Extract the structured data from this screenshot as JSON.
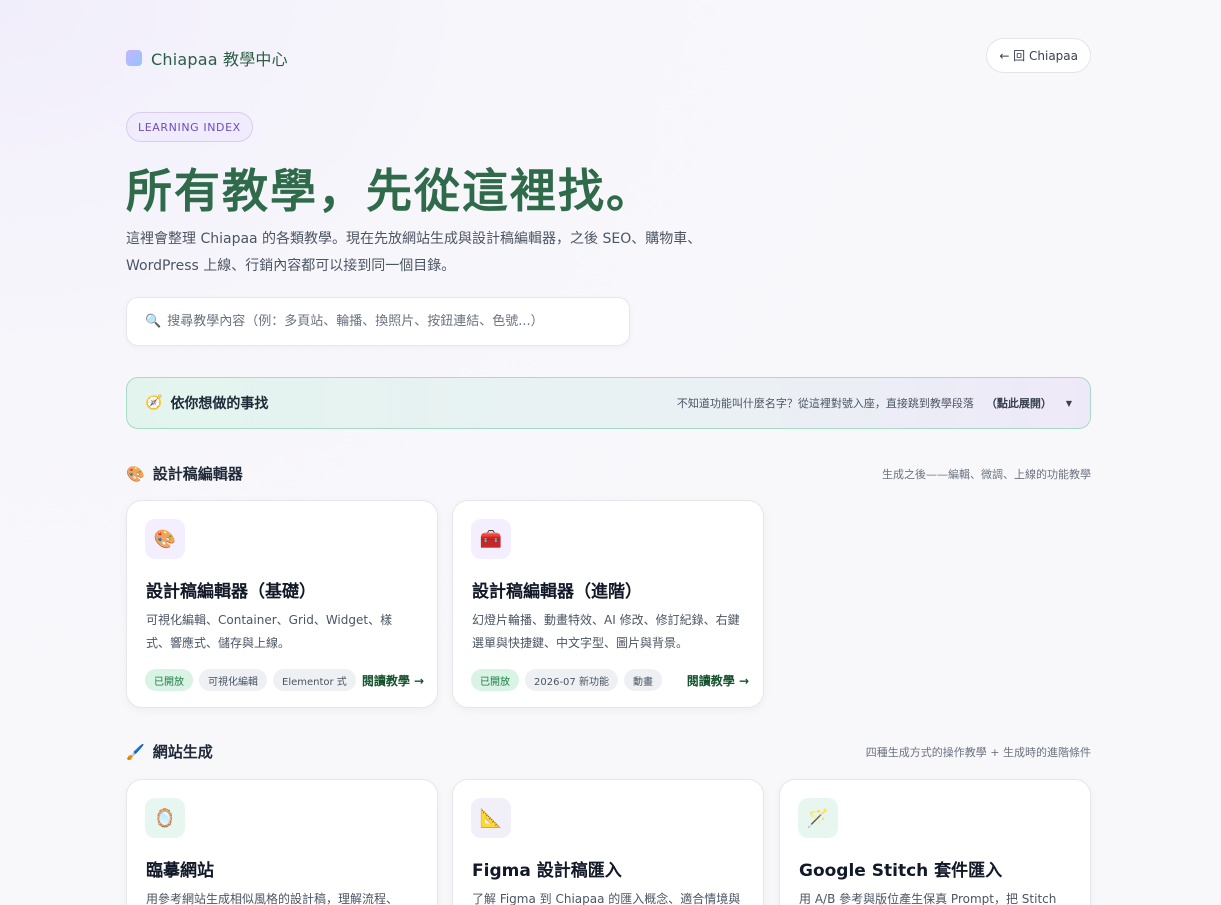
{
  "header": {
    "brand": "Chiapaa 教學中心",
    "back_button": "← 回 Chiapaa"
  },
  "hero": {
    "badge": "LEARNING INDEX",
    "title": "所有教學，先從這裡找。",
    "description": "這裡會整理 Chiapaa 的各類教學。現在先放網站生成與設計稿編輯器，之後 SEO、購物車、WordPress 上線、行銷內容都可以接到同一個目錄。"
  },
  "search": {
    "icon": "search-icon",
    "placeholder": "搜尋教學內容（例：多頁站、輪播、換照片、按鈕連結、色號...）",
    "value": ""
  },
  "guide": {
    "icon": "compass-icon",
    "title": "依你想做的事找",
    "hint": "不知道功能叫什麼名字？從這裡對號入座，直接跳到教學段落",
    "expand": "（點此展開）"
  },
  "sections": [
    {
      "icon": "palette-icon",
      "title": "設計稿編輯器",
      "subtitle": "生成之後——編輯、微調、上線的功能教學",
      "cards": [
        {
          "icon": "palette-icon",
          "icon_bg": "#f3efff",
          "title": "設計稿編輯器（基礎）",
          "description": "可視化編輯、Container、Grid、Widget、樣式、響應式、儲存與上線。",
          "tags": [
            "已開放",
            "可視化編輯",
            "Elementor 式"
          ],
          "link": "閱讀教學 →"
        },
        {
          "icon": "toolbox-icon",
          "icon_bg": "#f3efff",
          "title": "設計稿編輯器（進階）",
          "description": "幻燈片輪播、動畫特效、AI 修改、修訂紀錄、右鍵選單與快捷鍵、中文字型、圖片與背景。",
          "tags": [
            "已開放",
            "2026-07 新功能",
            "動畫"
          ],
          "link": "閱讀教學 →"
        }
      ]
    },
    {
      "icon": "brush-icon",
      "title": "網站生成",
      "subtitle": "四種生成方式的操作教學 + 生成時的進階條件",
      "cards": [
        {
          "icon": "mirror-icon",
          "icon_bg": "#e7f7ef",
          "title": "臨摹網站",
          "description": "用參考網站生成相似風格的設計稿，理解流程、",
          "tags": [],
          "link": ""
        },
        {
          "icon": "ruler-icon",
          "icon_bg": "#f1eff7",
          "title": "Figma 設計稿匯入",
          "description": "了解 Figma 到 Chiapaa 的匯入概念、適合情境與",
          "tags": [],
          "link": ""
        },
        {
          "icon": "magic-wand-icon",
          "icon_bg": "#e7f7ef",
          "title": "Google Stitch 套件匯入",
          "description": "用 A/B 參考與版位產生保真 Prompt，把 Stitch",
          "tags": [],
          "link": ""
        }
      ]
    }
  ]
}
